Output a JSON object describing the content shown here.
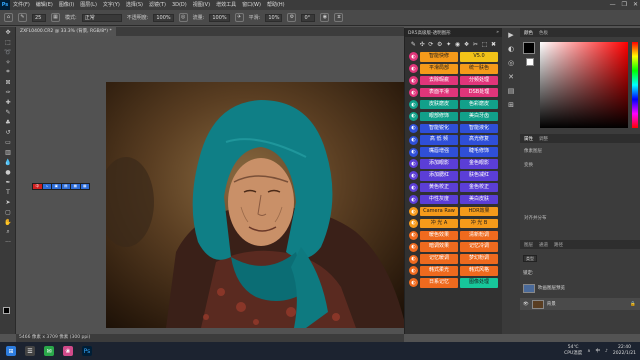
{
  "menubar": {
    "logo": "Ps",
    "items": [
      "文件(F)",
      "编辑(E)",
      "图像(I)",
      "图层(L)",
      "文字(Y)",
      "选择(S)",
      "滤镜(T)",
      "3D(D)",
      "视图(V)",
      "增效工具",
      "窗口(W)",
      "帮助(H)"
    ],
    "win_buttons": [
      "—",
      "❐",
      "✕"
    ]
  },
  "options": {
    "mode_label": "模式:",
    "mode_value": "正常",
    "opacity_label": "不透明度:",
    "opacity_value": "100%",
    "flow_label": "流量:",
    "flow_value": "100%",
    "smooth_label": "平滑:",
    "smooth_value": "10%",
    "brush_size": "25",
    "angle": "0°"
  },
  "document": {
    "tab_title": "ZXFL0400.CR2 @ 33.3% (背景, RGB/8*) *",
    "status": "5466 像素 x 3709 像素 (300 ppi)"
  },
  "mini_bar": {
    "items": [
      "中",
      "ゝ",
      "▣",
      "▤",
      "▦",
      "▩"
    ]
  },
  "plugin": {
    "title": "DR5高级版-透明图形",
    "icons": [
      "✎",
      "✣",
      "⟳",
      "⚙",
      "✦",
      "◉",
      "❖",
      "✂",
      "⬚",
      "✖"
    ],
    "rows": [
      {
        "icon": "◐",
        "color": "#e0357a",
        "left": "智能快修",
        "right": "V5.0",
        "lc": "pb-orange",
        "rc": "pb-yellow"
      },
      {
        "icon": "◐",
        "color": "#e0357a",
        "left": "平滑局部",
        "right": "统一肤色",
        "lc": "pb-orange",
        "rc": "pb-orange"
      },
      {
        "icon": "◐",
        "color": "#e0357a",
        "left": "去除瑕疵",
        "right": "分频处理",
        "lc": "pb-pink",
        "rc": "pb-pink"
      },
      {
        "icon": "◐",
        "color": "#e0357a",
        "left": "表面平滑",
        "right": "DSB处理",
        "lc": "pb-pink",
        "rc": "pb-pink"
      },
      {
        "icon": "◐",
        "color": "#12a08a",
        "left": "皮肤磨皮",
        "right": "色彩磨皮",
        "lc": "pb-teal",
        "rc": "pb-teal"
      },
      {
        "icon": "◐",
        "color": "#12a08a",
        "left": "眼部修饰",
        "right": "美白牙齿",
        "lc": "pb-teal",
        "rc": "pb-teal"
      },
      {
        "icon": "◐",
        "color": "#2f4fd8",
        "left": "智能锐化",
        "right": "智能液化",
        "lc": "pb-blue",
        "rc": "pb-blue"
      },
      {
        "icon": "◐",
        "color": "#2f4fd8",
        "left": "高 低 频",
        "right": "高光修复",
        "lc": "pb-blue",
        "rc": "pb-blue"
      },
      {
        "icon": "◐",
        "color": "#2f4fd8",
        "left": "嘴唇增强",
        "right": "睫毛修饰",
        "lc": "pb-blue",
        "rc": "pb-blue"
      },
      {
        "icon": "◐",
        "color": "#5b3ed6",
        "left": "添加眼影",
        "right": "金色眼影",
        "lc": "pb-violet",
        "rc": "pb-violet"
      },
      {
        "icon": "◐",
        "color": "#5b3ed6",
        "left": "添加腮红",
        "right": "肤色减红",
        "lc": "pb-violet",
        "rc": "pb-violet"
      },
      {
        "icon": "◐",
        "color": "#5b3ed6",
        "left": "黄色校正",
        "right": "金色校正",
        "lc": "pb-violet",
        "rc": "pb-violet"
      },
      {
        "icon": "◐",
        "color": "#5b3ed6",
        "left": "中性灰度",
        "right": "美白皮肤",
        "lc": "pb-violet",
        "rc": "pb-violet"
      },
      {
        "icon": "◐",
        "color": "#f59a1a",
        "left": "Camera Raw",
        "right": "HDR效果",
        "lc": "pb-orange",
        "rc": "pb-orange"
      },
      {
        "icon": "◐",
        "color": "#f59a1a",
        "left": "冲 光 A",
        "right": "冲 光 B",
        "lc": "pb-orange",
        "rc": "pb-orange"
      },
      {
        "icon": "◐",
        "color": "#ef6a1e",
        "left": "暖色效果",
        "right": "清新粉调",
        "lc": "pb-dorange",
        "rc": "pb-dorange"
      },
      {
        "icon": "◐",
        "color": "#ef6a1e",
        "left": "暗调效果",
        "right": "记忆冷调",
        "lc": "pb-dorange",
        "rc": "pb-dorange"
      },
      {
        "icon": "◐",
        "color": "#ef6a1e",
        "left": "记忆暖调",
        "right": "梦幻粉调",
        "lc": "pb-dorange",
        "rc": "pb-dorange"
      },
      {
        "icon": "◐",
        "color": "#ef6a1e",
        "left": "韩式柔光",
        "right": "韩式风格",
        "lc": "pb-dorange",
        "rc": "pb-dorange"
      },
      {
        "icon": "◐",
        "color": "#ef6a1e",
        "left": "日系记忆",
        "right": "图像处理",
        "lc": "pb-dorange",
        "rc": "pb-green"
      }
    ]
  },
  "right_panel": {
    "color_tabs": [
      "颜色",
      "色板"
    ],
    "props_tabs": [
      "属性",
      "调整"
    ],
    "props_title": "像素图层",
    "transform_label": "变换",
    "align_label": "对齐并分布",
    "layers_tabs": [
      "图层",
      "通道",
      "路径"
    ],
    "kind_label": "类型",
    "layer_name": "背景",
    "layer_label2": "吹画图层预览",
    "lock_label": "锁定:"
  },
  "sidecol": {
    "icons": [
      "▶",
      "◐",
      "◎",
      "✕",
      "▤",
      "⊞"
    ]
  },
  "taskbar": {
    "icons": [
      "⊞",
      "☰",
      "✉",
      "❀",
      "Ps"
    ],
    "weather_temp": "54℃",
    "weather_label": "CPU温度",
    "time": "22:40",
    "date": "2022/1/21",
    "tray": [
      "∧",
      "中",
      "♪"
    ]
  }
}
